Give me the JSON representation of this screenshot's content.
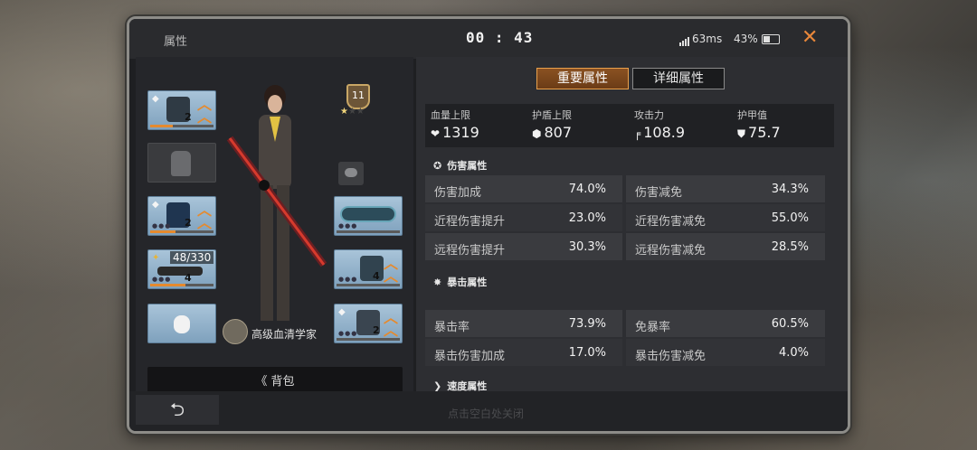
{
  "header": {
    "title": "属性",
    "timer": "00 : 43",
    "ping": "63ms",
    "battery": "43%",
    "close_icon": "close-icon"
  },
  "left": {
    "slots": [
      {
        "name": "helmet",
        "level": "2",
        "bar_fill": 0.35
      },
      {
        "name": "backpack-empty"
      },
      {
        "name": "armor",
        "level": "2",
        "bar_fill": 0.4
      },
      {
        "name": "primary-weapon",
        "ammo": "48/330",
        "level": "4",
        "bar_fill": 0.55
      },
      {
        "name": "pet"
      },
      {
        "name": "ring",
        "bar_fill": 0.0
      },
      {
        "name": "gloves",
        "level": "4",
        "bar_fill": 0.0
      },
      {
        "name": "boots",
        "level": "2",
        "bar_fill": 0.0
      }
    ],
    "rank_number": "11",
    "rank_stars_filled": 1,
    "rank_stars_total": 3,
    "title_label": "高级血清学家",
    "backpack_button": "《 背包"
  },
  "bottom": {
    "back_icon": "back-arrow-icon",
    "hint": "点击空白处关闭"
  },
  "right": {
    "tabs": [
      "重要属性",
      "详细属性"
    ],
    "active_tab": 0,
    "basic_stats": [
      {
        "label": "血量上限",
        "icon": "heart-icon",
        "value": "1319"
      },
      {
        "label": "护盾上限",
        "icon": "shield-icon",
        "value": "807"
      },
      {
        "label": "攻击力",
        "icon": "gun-icon",
        "value": "108.9"
      },
      {
        "label": "护甲值",
        "icon": "armor-icon",
        "value": "75.7"
      }
    ],
    "sections": [
      {
        "title": "伤害属性",
        "rows": [
          [
            {
              "k": "伤害加成",
              "v": "74.0%"
            },
            {
              "k": "伤害减免",
              "v": "34.3%"
            }
          ],
          [
            {
              "k": "近程伤害提升",
              "v": "23.0%"
            },
            {
              "k": "近程伤害减免",
              "v": "55.0%"
            }
          ],
          [
            {
              "k": "远程伤害提升",
              "v": "30.3%"
            },
            {
              "k": "远程伤害减免",
              "v": "28.5%"
            }
          ]
        ]
      },
      {
        "title": "暴击属性",
        "rows": [
          [
            {
              "k": "暴击率",
              "v": "73.9%"
            },
            {
              "k": "免暴率",
              "v": "60.5%"
            }
          ],
          [
            {
              "k": "暴击伤害加成",
              "v": "17.0%"
            },
            {
              "k": "暴击伤害减免",
              "v": "4.0%"
            }
          ]
        ]
      },
      {
        "title": "速度属性",
        "rows": []
      }
    ]
  },
  "colors": {
    "accent_orange": "#e58a2e",
    "tab_active": "#8a5222",
    "panel": "#2d2e32"
  }
}
